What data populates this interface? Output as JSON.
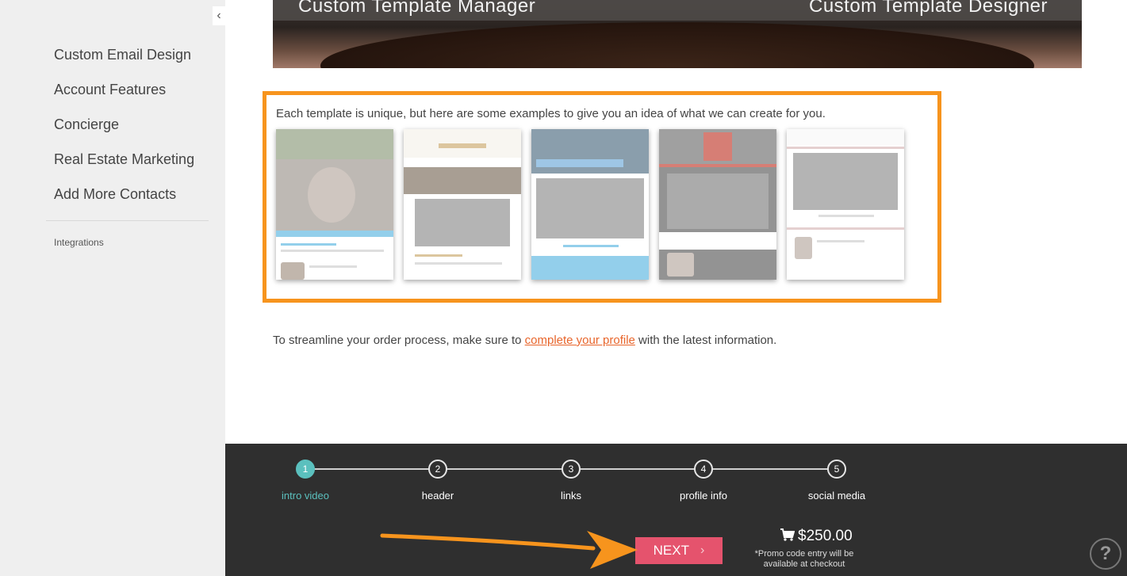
{
  "sidebar": {
    "collapse_icon": "chevron-left-icon",
    "collapse_glyph": "‹",
    "items": [
      {
        "label": "Custom Email Design"
      },
      {
        "label": "Account Features"
      },
      {
        "label": "Concierge"
      },
      {
        "label": "Real Estate Marketing"
      },
      {
        "label": "Add More Contacts"
      }
    ],
    "sub_item": "Integrations"
  },
  "hero": {
    "left_label": "Custom Template Manager",
    "right_label": "Custom Template Designer"
  },
  "examples": {
    "intro": "Each template is unique, but here are some examples to give you an idea of what we can create for you.",
    "highlight_color": "#f7941d"
  },
  "profile_note": {
    "before": "To streamline your order process, make sure to ",
    "link": "complete your profile",
    "after": " with the latest information."
  },
  "steps": [
    {
      "number": "1",
      "label": "intro video",
      "active": true
    },
    {
      "number": "2",
      "label": "header",
      "active": false
    },
    {
      "number": "3",
      "label": "links",
      "active": false
    },
    {
      "number": "4",
      "label": "profile info",
      "active": false
    },
    {
      "number": "5",
      "label": "social media",
      "active": false
    }
  ],
  "footer": {
    "next_label": "NEXT",
    "next_chevron": "›",
    "price": "$250.00",
    "cart_icon": "cart-icon",
    "promo_note": "*Promo code entry will be available at checkout",
    "help_glyph": "?"
  },
  "colors": {
    "accent": "#5bc0be",
    "next_button": "#e5536d",
    "link": "#e8652b",
    "footer_bg": "#2f2f2f"
  }
}
